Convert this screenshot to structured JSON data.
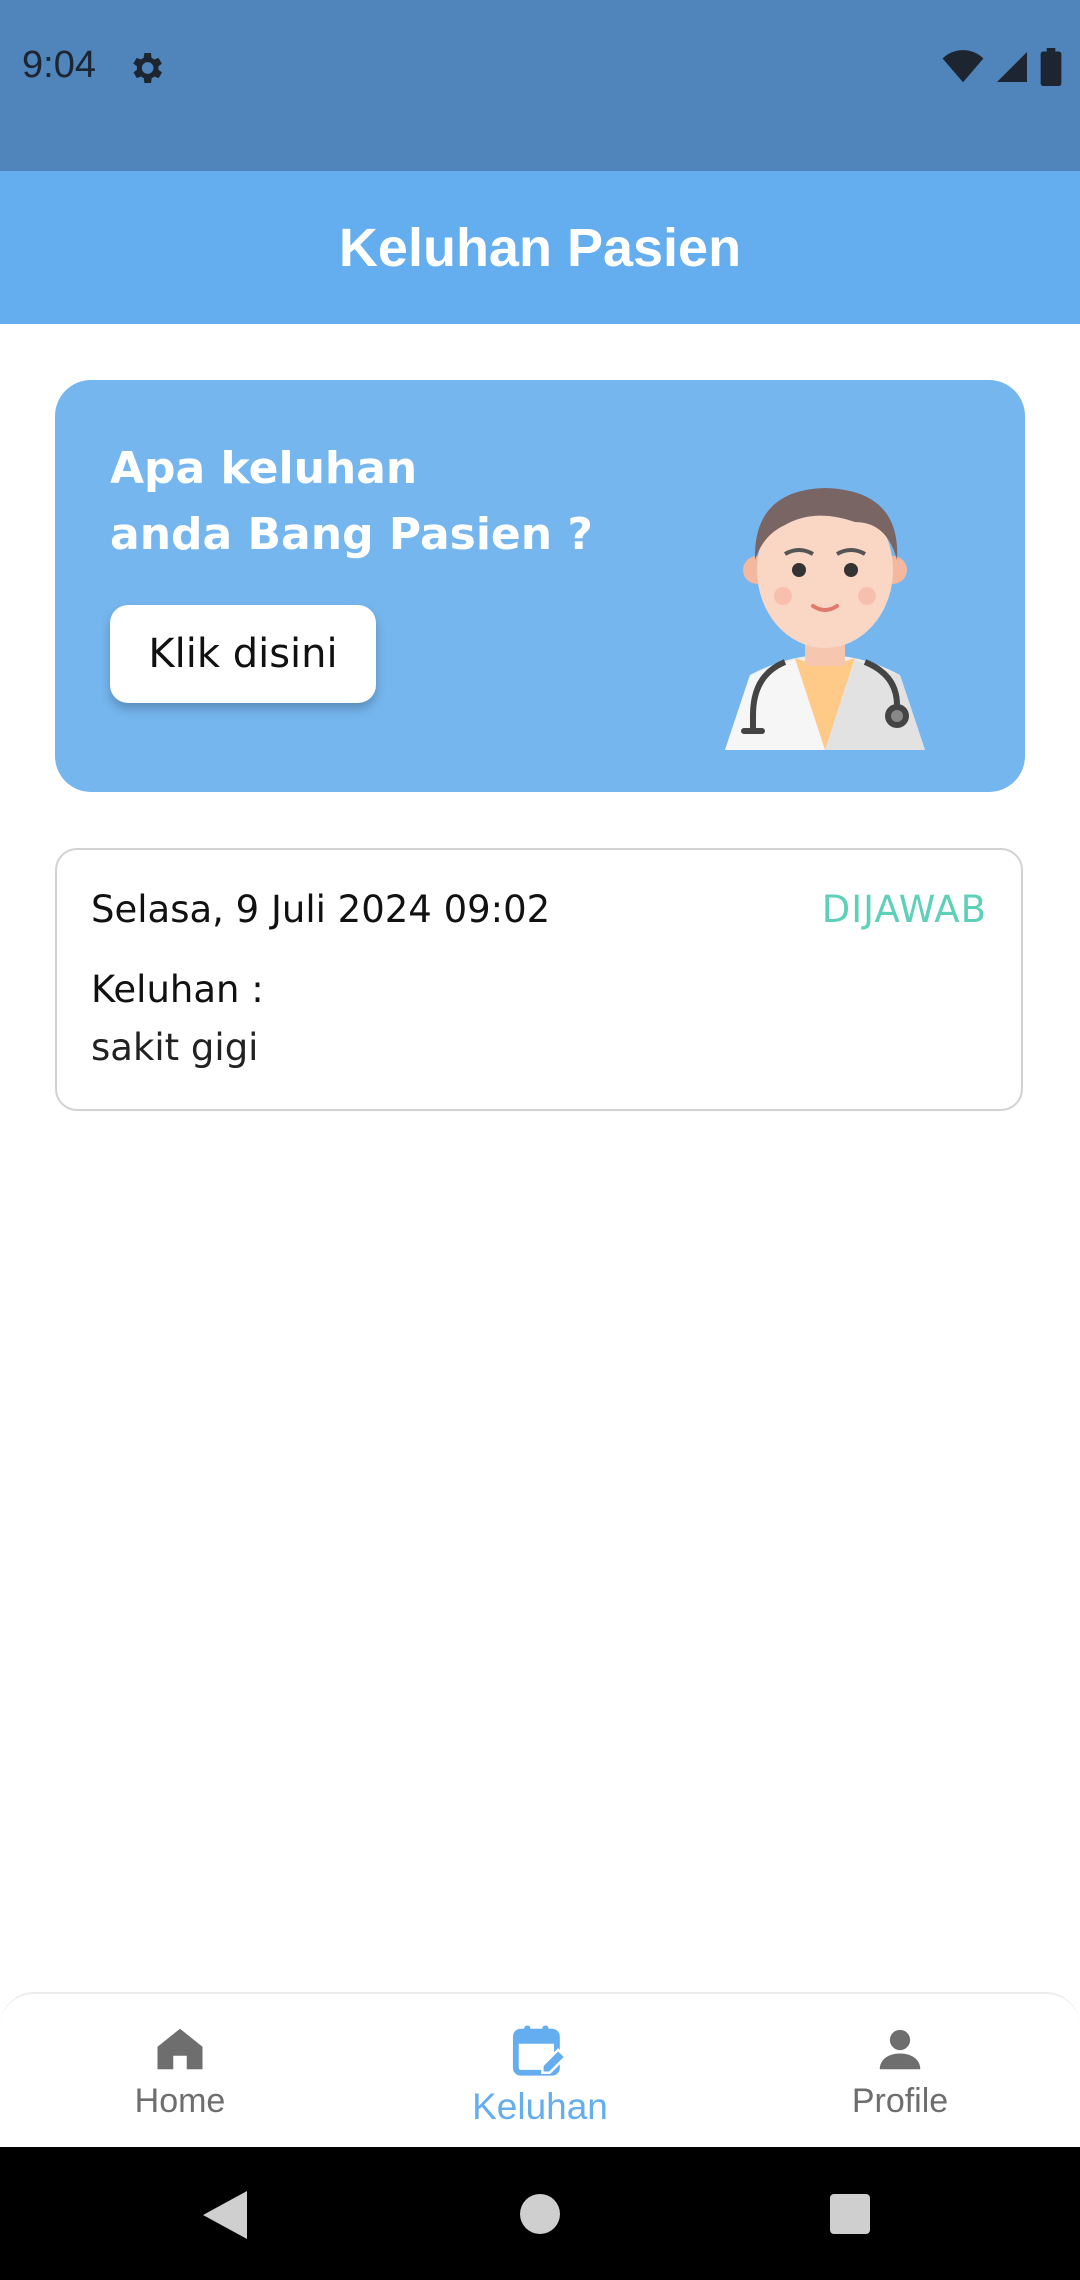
{
  "status_bar": {
    "time": "9:04",
    "icons": [
      "gear-icon",
      "wifi-icon",
      "signal-icon",
      "battery-icon"
    ]
  },
  "app_bar": {
    "title": "Keluhan Pasien"
  },
  "banner": {
    "line1": "Apa keluhan",
    "line2": "anda Bang Pasien ?",
    "button_label": "Klik disini"
  },
  "complaint": {
    "date": "Selasa, 9 Juli 2024 09:02",
    "status": "DIJAWAB",
    "label": "Keluhan :",
    "value": "sakit gigi"
  },
  "bottom_nav": {
    "items": [
      {
        "label": "Home",
        "icon": "home-icon",
        "active": false
      },
      {
        "label": "Keluhan",
        "icon": "calendar-edit-icon",
        "active": true
      },
      {
        "label": "Profile",
        "icon": "person-icon",
        "active": false
      }
    ]
  },
  "colors": {
    "status_bar": "#4f85ba",
    "app_bar": "#64adef",
    "banner": "#75b6ef",
    "status_answered": "#5fd0b8",
    "nav_active": "#64adef",
    "nav_inactive": "#6e6e6e"
  }
}
